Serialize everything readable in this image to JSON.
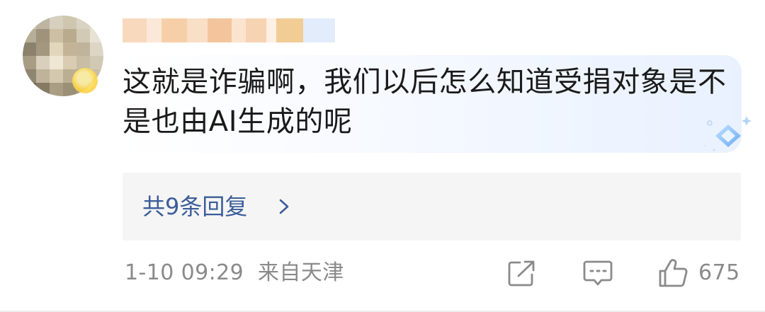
{
  "comment": {
    "text": "这就是诈骗啊，我们以后怎么知道受捐对象是不是也由AI生成的呢"
  },
  "replies": {
    "label": "共9条回复"
  },
  "meta": {
    "timestamp": "1-10 09:29",
    "location": "来自天津"
  },
  "actions": {
    "share_icon": "share-icon",
    "comment_icon": "comment-icon",
    "like_icon": "thumbs-up-icon",
    "like_count": "675"
  },
  "colors": {
    "reply_link": "#3b5d99",
    "meta_text": "#8a8a8a",
    "reply_box_bg": "#f5f5f5"
  }
}
